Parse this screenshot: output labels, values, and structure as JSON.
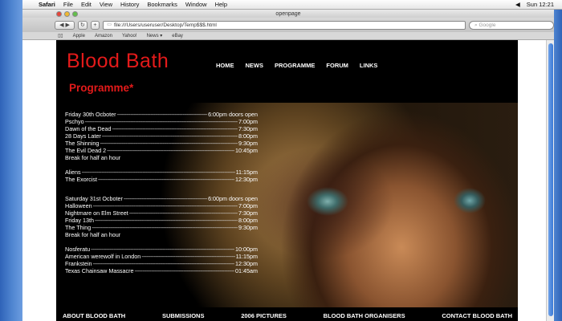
{
  "menubar": {
    "items": [
      "Safari",
      "File",
      "Edit",
      "View",
      "History",
      "Bookmarks",
      "Window",
      "Help"
    ],
    "clock": "Sun 12:21"
  },
  "window": {
    "title": "openpage",
    "address": "file:///Users/useruser/Desktop/Temp$$$.html",
    "search_placeholder": "Google",
    "bookmarks": [
      "Apple",
      "Amazon",
      "Yahoo!",
      "News ▾",
      "eBay"
    ]
  },
  "site": {
    "brand": "Blood Bath",
    "subtitle": "Programme*",
    "nav": [
      "HOME",
      "NEWS",
      "PROGRAMME",
      "FORUM",
      "LINKS"
    ],
    "footer": [
      "ABOUT BLOOD BATH",
      "SUBMISSIONS",
      "2006 PICTURES",
      "BLOOD BATH ORGANISERS",
      "CONTACT BLOOD BATH"
    ]
  },
  "programme": {
    "friday": {
      "header": {
        "film": "Friday 30th Ocboter",
        "time": "6:00pm doors open"
      },
      "films": [
        {
          "film": "Pschyo",
          "time": "7:00pm"
        },
        {
          "film": "Dawn of the Dead",
          "time": "7:30pm"
        },
        {
          "film": "28 Days Later",
          "time": "8:00pm"
        },
        {
          "film": "The Shinning",
          "time": "9:30pm"
        },
        {
          "film": "The Evil Dead 2",
          "time": "10:45pm"
        }
      ],
      "break": "Break for half an hour",
      "late": [
        {
          "film": "Aliens",
          "time": "11:15pm"
        },
        {
          "film": "The Exorcist",
          "time": "12:30pm"
        }
      ]
    },
    "saturday": {
      "header": {
        "film": "Saturday 31st Ocboter",
        "time": "6:00pm doors open"
      },
      "films": [
        {
          "film": "Halloween",
          "time": "7:00pm"
        },
        {
          "film": "Nightmare on Elm Street",
          "time": "7:30pm"
        },
        {
          "film": "Friday 13th",
          "time": "8:00pm"
        },
        {
          "film": "The Thing",
          "time": "9:30pm"
        }
      ],
      "break": "Break for half an hour",
      "late": [
        {
          "film": "Nosferatu",
          "time": "10:00pm"
        },
        {
          "film": "American werewolf in London",
          "time": "11:15pm"
        },
        {
          "film": "Frankstein",
          "time": "12:30pm"
        },
        {
          "film": "Texas Chainsaw Massacre",
          "time": "01:45am"
        }
      ]
    }
  },
  "colors": {
    "brand_red": "#e31a1a",
    "page_bg": "#000000"
  }
}
